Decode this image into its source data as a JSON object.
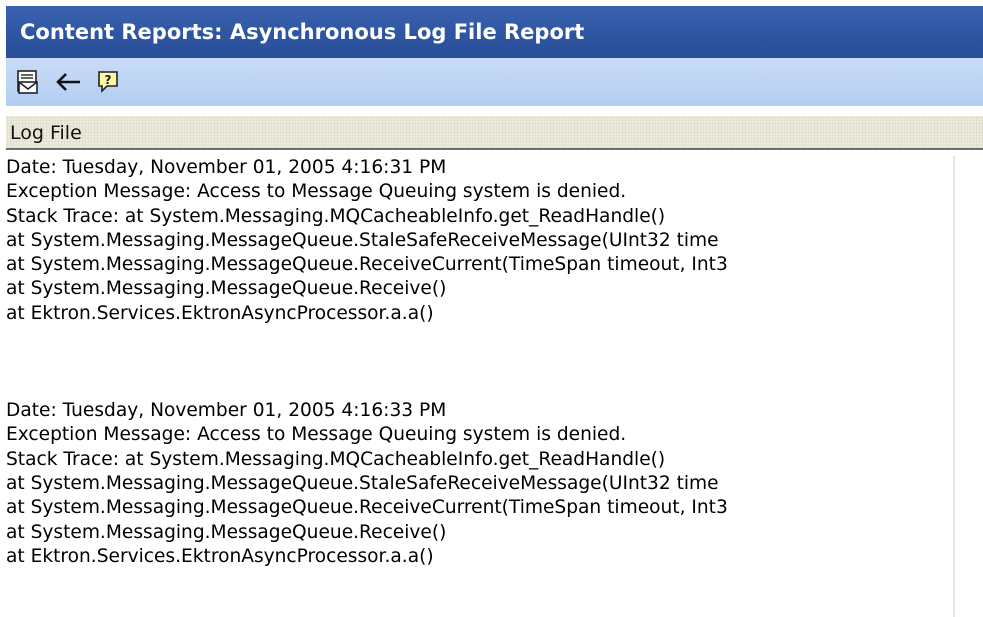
{
  "window": {
    "title": "Content Reports: Asynchronous Log File Report"
  },
  "toolbar": {
    "buttons": [
      {
        "icon": "email-report-icon"
      },
      {
        "icon": "back-arrow-icon"
      },
      {
        "icon": "help-icon"
      }
    ]
  },
  "section": {
    "header": "Log File"
  },
  "log": {
    "entries": [
      {
        "lines": [
          "Date: Tuesday, November 01, 2005 4:16:31 PM",
          "Exception Message: Access to Message Queuing system is denied.",
          "Stack Trace: at System.Messaging.MQCacheableInfo.get_ReadHandle()",
          "at System.Messaging.MessageQueue.StaleSafeReceiveMessage(UInt32 time",
          "at System.Messaging.MessageQueue.ReceiveCurrent(TimeSpan timeout, Int3",
          "at System.Messaging.MessageQueue.Receive()",
          "at Ektron.Services.EktronAsyncProcessor.a.a()"
        ]
      },
      {
        "lines": [
          "Date: Tuesday, November 01, 2005 4:16:33 PM",
          "Exception Message: Access to Message Queuing system is denied.",
          "Stack Trace: at System.Messaging.MQCacheableInfo.get_ReadHandle()",
          "at System.Messaging.MessageQueue.StaleSafeReceiveMessage(UInt32 time",
          "at System.Messaging.MessageQueue.ReceiveCurrent(TimeSpan timeout, Int3",
          "at System.Messaging.MessageQueue.Receive()",
          "at Ektron.Services.EktronAsyncProcessor.a.a()"
        ]
      }
    ]
  }
}
